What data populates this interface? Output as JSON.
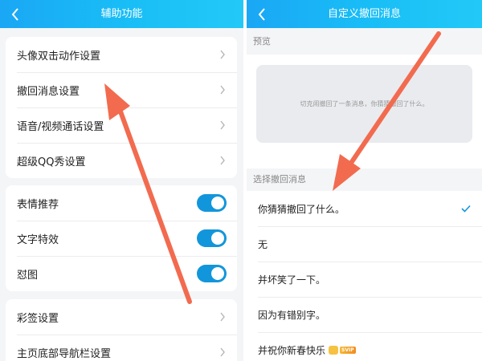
{
  "left": {
    "title": "辅助功能",
    "group1": [
      "头像双击动作设置",
      "撤回消息设置",
      "语音/视频通话设置",
      "超级QQ秀设置"
    ],
    "group2": [
      "表情推荐",
      "文字特效",
      "怼图"
    ],
    "group2_toggles": [
      true,
      true,
      true
    ],
    "group3": [
      "彩签设置",
      "主页底部导航栏设置"
    ]
  },
  "right": {
    "title": "自定义撤回消息",
    "preview_label": "预览",
    "preview_text": "切克闹撤回了一条消息，你猜猜撤回了什么。",
    "select_label": "选择撤回消息",
    "options": [
      "你猜猜撤回了什么。",
      "无",
      "并坏笑了一下。",
      "因为有错别字。",
      "并祝你新春快乐"
    ],
    "selected_index": 0,
    "svip_badge": "SVIP"
  },
  "colors": {
    "header": "#1aa7f5",
    "toggle": "#1296db",
    "arrow": "#f26b4f",
    "check": "#1296db"
  }
}
